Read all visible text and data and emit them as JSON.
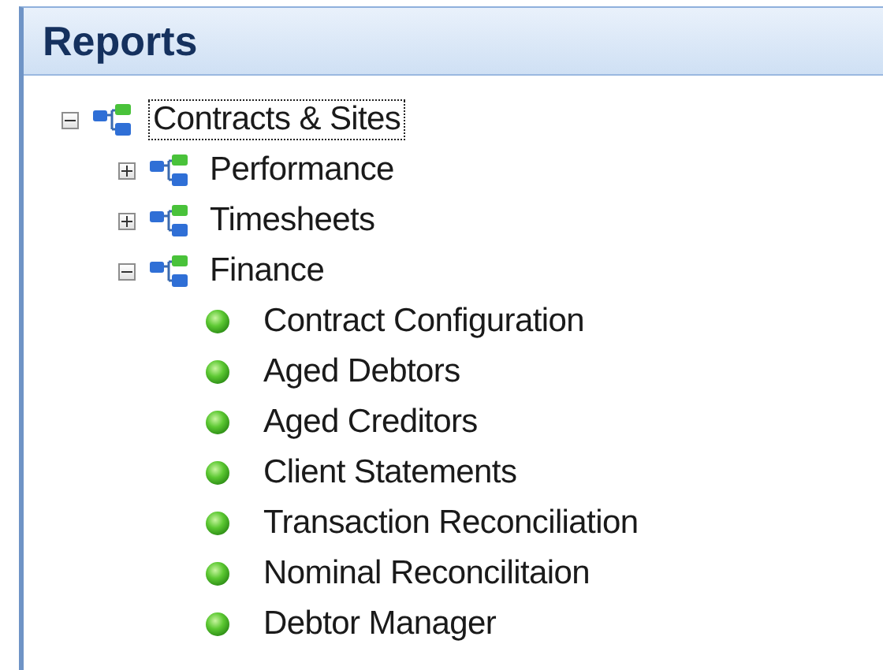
{
  "panel": {
    "title": "Reports"
  },
  "tree": [
    {
      "kind": "group",
      "label": "Contracts & Sites",
      "expanded": true,
      "focused": true,
      "children": [
        {
          "kind": "group",
          "label": "Performance",
          "expanded": false,
          "focused": false
        },
        {
          "kind": "group",
          "label": "Timesheets",
          "expanded": false,
          "focused": false
        },
        {
          "kind": "group",
          "label": "Finance",
          "expanded": true,
          "focused": false,
          "children": [
            {
              "kind": "report",
              "label": "Contract Configuration",
              "focused": false
            },
            {
              "kind": "report",
              "label": "Aged Debtors",
              "focused": false
            },
            {
              "kind": "report",
              "label": "Aged Creditors",
              "focused": false
            },
            {
              "kind": "report",
              "label": "Client Statements",
              "focused": false
            },
            {
              "kind": "report",
              "label": "Transaction Reconciliation",
              "focused": false
            },
            {
              "kind": "report",
              "label": "Nominal Reconcilitaion",
              "focused": false
            },
            {
              "kind": "report",
              "label": "Debtor Manager",
              "focused": false
            }
          ]
        }
      ]
    }
  ]
}
